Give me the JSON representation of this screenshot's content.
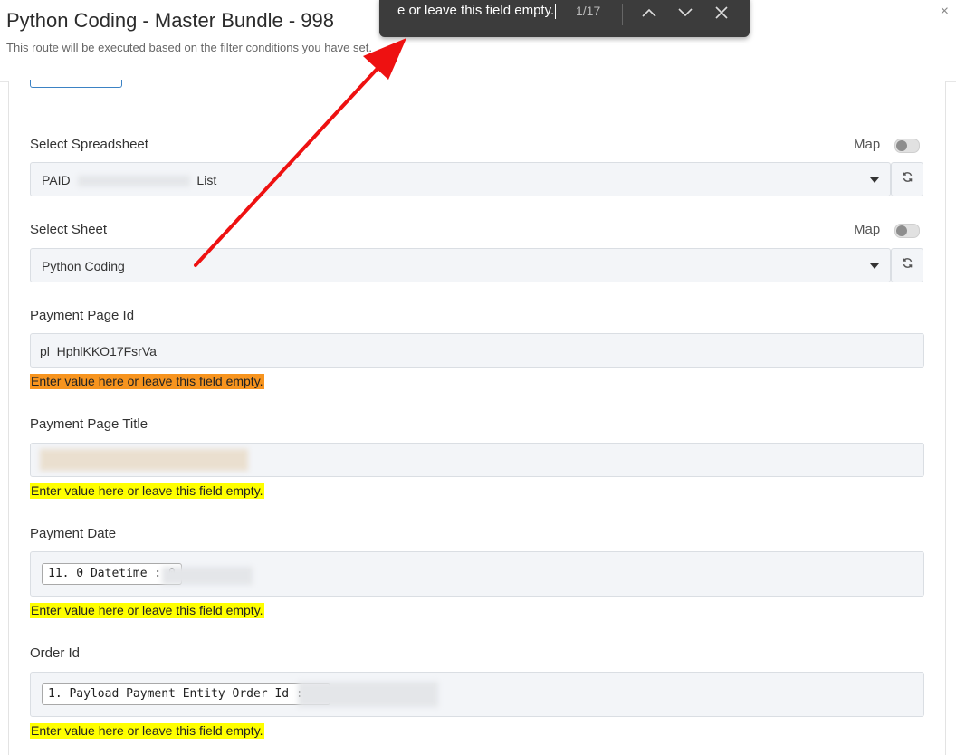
{
  "header": {
    "title": "Python Coding - Master Bundle - 998",
    "subtitle": "This route will be executed based on the filter conditions you have set.",
    "close_glyph": "×"
  },
  "findbar": {
    "query": "e or leave this field empty.",
    "count": "1/17",
    "icons": [
      "chevron-up-icon",
      "chevron-down-icon",
      "close-icon"
    ]
  },
  "spreadsheet": {
    "label": "Select Spreadsheet",
    "map_label": "Map",
    "value_prefix": "PAID",
    "value_suffix": "List"
  },
  "sheet": {
    "label": "Select Sheet",
    "map_label": "Map",
    "value": "Python Coding"
  },
  "payment_page_id": {
    "label": "Payment Page Id",
    "value": "pl_HphlKKO17FsrVa",
    "hint": "Enter value here or leave this field empty."
  },
  "payment_page_title": {
    "label": "Payment Page Title",
    "hint": "Enter value here or leave this field empty."
  },
  "payment_date": {
    "label": "Payment Date",
    "chip": "11. 0 Datetime : 0",
    "hint": "Enter value here or leave this field empty."
  },
  "order_id": {
    "label": "Order Id",
    "chip": "1. Payload Payment Entity Order Id : or",
    "hint": "Enter value here or leave this field empty."
  },
  "colors": {
    "highlight_active": "#f7941e",
    "highlight": "#ffff00",
    "arrow": "#ee1111",
    "findbar_bg": "#3c3c3c"
  }
}
